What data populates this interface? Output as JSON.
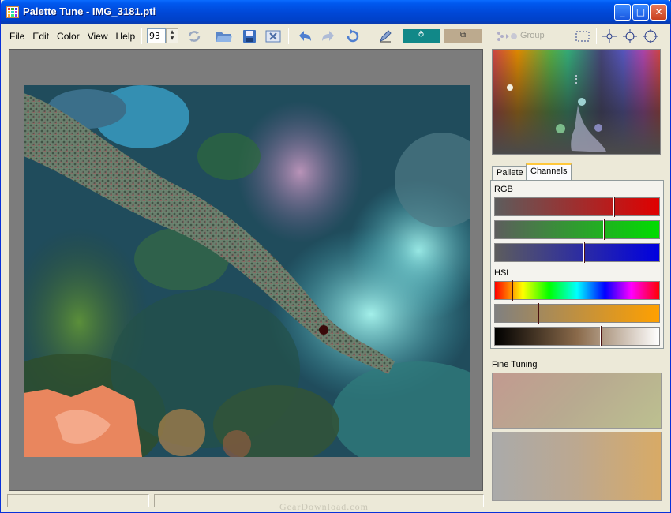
{
  "window": {
    "title": "Palette Tune - IMG_3181.pti"
  },
  "titlebar_buttons": [
    "_",
    "□",
    "✕"
  ],
  "menu": [
    {
      "label": "File"
    },
    {
      "label": "Edit"
    },
    {
      "label": "Color"
    },
    {
      "label": "View"
    },
    {
      "label": "Help"
    }
  ],
  "toolbar": {
    "zoom_value": "93",
    "group_label": "Group",
    "icons": [
      "refresh-icon",
      "open-folder-icon",
      "save-icon",
      "close-file-icon",
      "undo-icon",
      "redo-icon",
      "reset-icon",
      "pen-icon",
      "rotate-swatch-icon",
      "copy-swatch-icon",
      "group-icon",
      "select-rect-icon",
      "point-small-icon",
      "point-medium-icon",
      "point-large-icon"
    ],
    "swatch_colors": {
      "rotate": "#118888",
      "copy": "#bcaa8e"
    }
  },
  "right_panel": {
    "tabs": [
      {
        "label": "Pallete"
      },
      {
        "label": "Channels",
        "active": true
      }
    ],
    "rgb_label": "RGB",
    "hsl_label": "HSL",
    "fine_tuning_label": "Fine Tuning",
    "sliders": [
      {
        "name": "red",
        "level": 0.72
      },
      {
        "name": "green",
        "level": 0.66
      },
      {
        "name": "blue",
        "level": 0.54
      },
      {
        "name": "hue",
        "level": 0.1
      },
      {
        "name": "saturation",
        "level": 0.26
      },
      {
        "name": "lightness",
        "level": 0.64
      }
    ]
  },
  "footer": {
    "watermark": "GearDownload.com"
  }
}
